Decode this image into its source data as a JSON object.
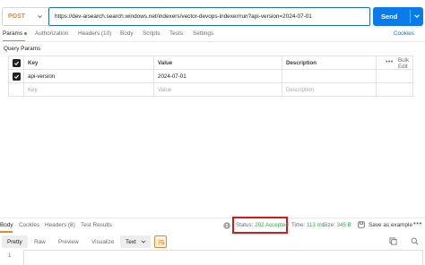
{
  "request": {
    "method": "POST",
    "url": "https://dev-aisearch.search.windows.net/indexers/vector-devops-indexer/run?api-version=2024-07-01",
    "send_label": "Send"
  },
  "request_tabs": [
    {
      "label": "Params"
    },
    {
      "label": "Authorization"
    },
    {
      "label": "Headers (10)"
    },
    {
      "label": "Body"
    },
    {
      "label": "Scripts"
    },
    {
      "label": "Tests"
    },
    {
      "label": "Settings"
    }
  ],
  "cookies_label": "Cookies",
  "query_params": {
    "title": "Query Params",
    "columns": {
      "key": "Key",
      "value": "Value",
      "description": "Description"
    },
    "bulk_edit_label": "Bulk Edit",
    "rows": [
      {
        "key": "api-version",
        "value": "2024-07-01",
        "description": ""
      }
    ],
    "placeholder": {
      "key": "Key",
      "value": "Value",
      "description": "Description"
    }
  },
  "response_tabs": [
    {
      "label": "Body"
    },
    {
      "label": "Cookies"
    },
    {
      "label": "Headers (8)"
    },
    {
      "label": "Test Results"
    }
  ],
  "response_meta": {
    "status_label": "Status:",
    "status_value": "202 Accepted",
    "time_label": "Time:",
    "time_value": "113 ms",
    "size_label": "Size:",
    "size_value": "345 B",
    "save_label": "Save as example"
  },
  "format_bar": {
    "modes": [
      {
        "label": "Pretty"
      },
      {
        "label": "Raw"
      },
      {
        "label": "Preview"
      },
      {
        "label": "Visualize"
      }
    ],
    "type_label": "Text"
  },
  "editor": {
    "line_number": "1"
  },
  "colors": {
    "accent_orange": "#e08a2e",
    "send_blue": "#097bed",
    "url_border": "#1a6ec1",
    "status_green": "#2eaa4b",
    "highlight_red": "#e0151a"
  },
  "icons": [
    "chevron-down-icon",
    "checkbox-checked-icon",
    "more-horizontal-icon",
    "globe-icon",
    "save-icon",
    "wrap-lines-icon",
    "copy-icon",
    "search-icon"
  ]
}
